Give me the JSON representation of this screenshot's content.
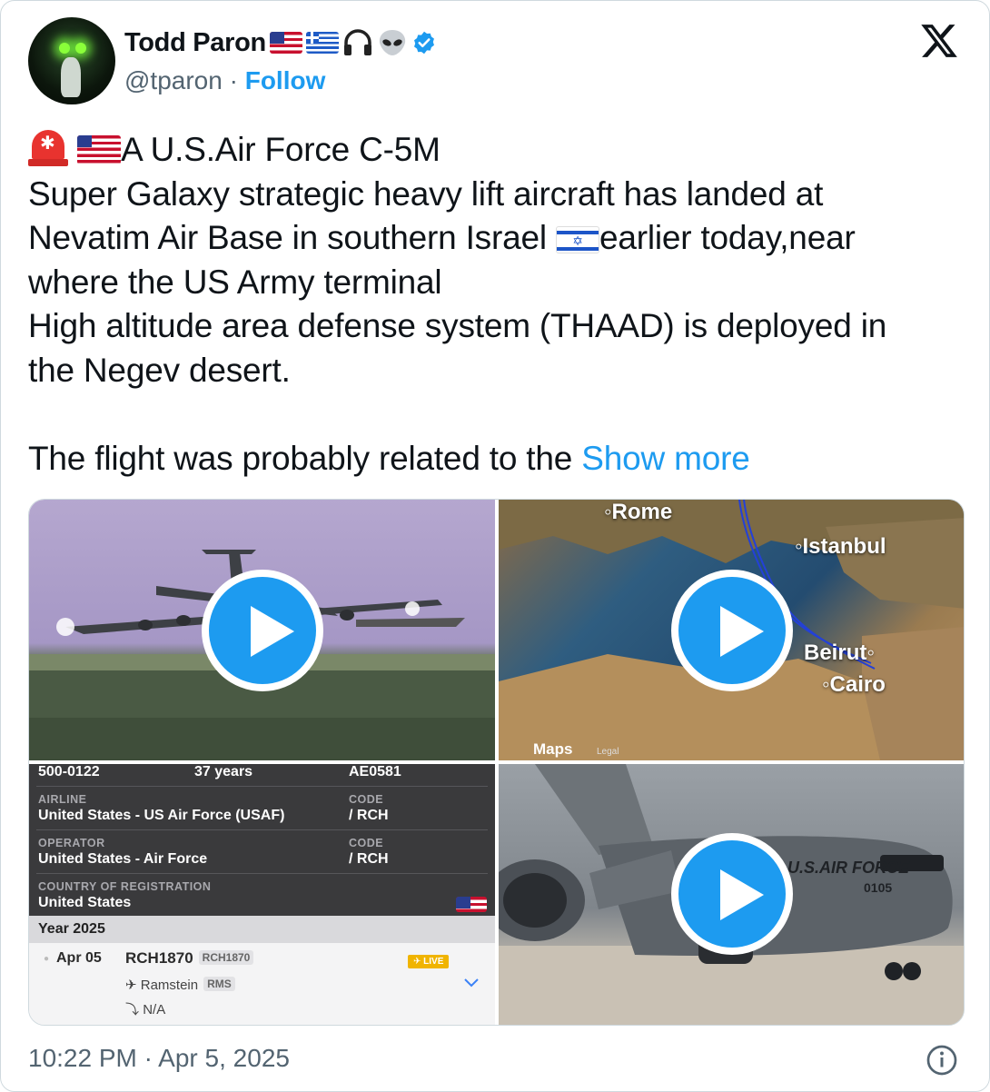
{
  "user": {
    "display_name": "Todd Paron",
    "handle": "@tparon",
    "separator": "·",
    "follow_label": "Follow",
    "name_icons": [
      "us-flag-icon",
      "greece-flag-icon",
      "headphones-icon",
      "alien-icon",
      "verified-badge-icon"
    ]
  },
  "tweet": {
    "line1": "A U.S.Air Force C-5M",
    "line2": "Super Galaxy strategic heavy lift aircraft has landed at",
    "line3a": "Nevatim Air Base in southern Israel",
    "line3b": "earlier today,near",
    "line4": "where the US Army terminal",
    "line5": "High altitude area defense system (THAAD) is deployed in",
    "line6": "the Negev desert.",
    "line7": "The flight was probably related to the",
    "show_more": "Show more"
  },
  "media": {
    "map": {
      "rome": "Rome",
      "istanbul": "Istanbul",
      "beirut": "Beirut",
      "cairo": "Cairo",
      "brand": "Maps",
      "legal": "Legal"
    },
    "flight_info": {
      "reg": "500-0122",
      "age": "37 years",
      "hex": "AE0581",
      "airline_label": "AIRLINE",
      "airline_value": "United States - US Air Force (USAF)",
      "code_label": "CODE",
      "code_value": "/ RCH",
      "operator_label": "OPERATOR",
      "operator_value": "United States - Air Force",
      "country_label": "COUNTRY OF REGISTRATION",
      "country_value": "United States",
      "year": "Year 2025",
      "flight_date": "Apr 05",
      "flight_callsign": "RCH1870",
      "flight_chip": "RCH1870",
      "live": "LIVE",
      "origin": "Ramstein",
      "origin_code": "RMS",
      "destination": "N/A"
    },
    "aircraft": {
      "livery_text": "U.S.AIR FORCE",
      "tail_number": "0105"
    }
  },
  "footer": {
    "timestamp": "10:22 PM · Apr 5, 2025"
  },
  "colors": {
    "accent": "#1d9bf0",
    "text": "#0f1419",
    "muted": "#536471"
  }
}
